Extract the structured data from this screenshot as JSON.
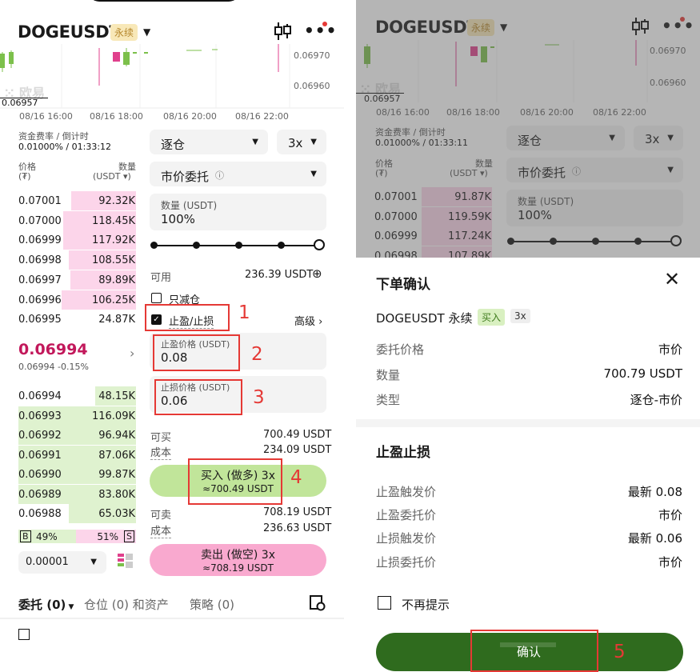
{
  "left": {
    "pair": "DOGEUSDT",
    "badge": "永续",
    "price_ticks": [
      "0.06970",
      "0.06960"
    ],
    "last_price_tag": "0.06957",
    "time_ticks": [
      "08/16 16:00",
      "08/16 18:00",
      "08/16 20:00",
      "08/16 22:00"
    ],
    "watermark": "欧易",
    "funding_label": "资金费率 / 倒计时",
    "funding_value": "0.01000% / 01:33:12",
    "price_col": "价格",
    "price_unit": "(₮)",
    "qty_col": "数量",
    "qty_unit": "(USDT ▾)",
    "asks": [
      {
        "price": "0.07001",
        "qty": "92.32K",
        "depth": 0.55
      },
      {
        "price": "0.07000",
        "qty": "118.45K",
        "depth": 0.62
      },
      {
        "price": "0.06999",
        "qty": "117.92K",
        "depth": 0.62
      },
      {
        "price": "0.06998",
        "qty": "108.55K",
        "depth": 0.57
      },
      {
        "price": "0.06997",
        "qty": "89.89K",
        "depth": 0.56
      },
      {
        "price": "0.06996",
        "qty": "106.25K",
        "depth": 0.63
      },
      {
        "price": "0.06995",
        "qty": "24.87K",
        "depth": 0.0
      }
    ],
    "mid_price": "0.06994",
    "mid_sub": "0.06994 -0.15%",
    "bids": [
      {
        "price": "0.06994",
        "qty": "48.15K",
        "depth": 0.35
      },
      {
        "price": "0.06993",
        "qty": "116.09K",
        "depth": 1.0
      },
      {
        "price": "0.06992",
        "qty": "96.94K",
        "depth": 1.0
      },
      {
        "price": "0.06991",
        "qty": "87.06K",
        "depth": 1.0
      },
      {
        "price": "0.06990",
        "qty": "99.87K",
        "depth": 1.0
      },
      {
        "price": "0.06989",
        "qty": "83.80K",
        "depth": 1.0
      },
      {
        "price": "0.06988",
        "qty": "65.03K",
        "depth": 0.57
      }
    ],
    "buy_ratio_badge": "B",
    "buy_ratio": "49%",
    "sell_ratio": "51%",
    "sell_ratio_badge": "S",
    "buy_ratio_value": 0.49,
    "precision": "0.00001",
    "margin_mode": "逐仓",
    "leverage": "3x",
    "order_type": "市价委托",
    "qty_label": "数量 (USDT)",
    "qty_value": "100%",
    "available_label": "可用",
    "available_value": "236.39 USDT",
    "reduce_only": "只减仓",
    "tpsl": "止盈/止损",
    "advanced": "高级",
    "tp_label": "止盈价格 (USDT)",
    "tp_value": "0.08",
    "sl_label": "止损价格 (USDT)",
    "sl_value": "0.06",
    "can_buy_label": "可买",
    "can_buy_value": "700.49 USDT",
    "cost_label": "成本",
    "cost_buy_value": "234.09 USDT",
    "buy_btn": "买入 (做多) 3x",
    "buy_btn_sub": "≈700.49 USDT",
    "can_sell_label": "可卖",
    "can_sell_value": "708.19 USDT",
    "cost_sell_value": "236.63 USDT",
    "sell_btn": "卖出 (做空) 3x",
    "sell_btn_sub": "≈708.19 USDT",
    "tab_orders": "委托 (0)",
    "tab_positions": "仓位 (0) 和资产",
    "tab_strategy": "策略 (0)",
    "annotations": [
      "1",
      "2",
      "3",
      "4"
    ]
  },
  "right": {
    "pair": "DOGEUSDT",
    "badge": "永续",
    "price_ticks": [
      "0.06970",
      "0.06960"
    ],
    "last_price_tag": "0.06957",
    "time_ticks": [
      "08/16 16:00",
      "08/16 18:00",
      "08/16 20:00",
      "08/16 22:00"
    ],
    "watermark": "欧易",
    "funding_label": "资金费率 / 倒计时",
    "funding_value": "0.01000% / 01:33:11",
    "price_col": "价格",
    "price_unit": "(₮)",
    "qty_col": "数量",
    "qty_unit": "(USDT ▾)",
    "asks": [
      {
        "price": "0.07001",
        "qty": "91.87K"
      },
      {
        "price": "0.07000",
        "qty": "119.59K"
      },
      {
        "price": "0.06999",
        "qty": "117.24K"
      },
      {
        "price": "0.06998",
        "qty": "107.89K"
      }
    ],
    "margin_mode": "逐仓",
    "leverage": "3x",
    "order_type": "市价委托",
    "qty_label": "数量 (USDT)",
    "qty_value": "100%",
    "sheet_title": "下单确认",
    "sheet_pair": "DOGEUSDT 永续",
    "tag_buy": "买入",
    "tag_lev": "3x",
    "rows": [
      {
        "k": "委托价格",
        "v": "市价"
      },
      {
        "k": "数量",
        "v": "700.79 USDT"
      },
      {
        "k": "类型",
        "v": "逐仓-市价"
      }
    ],
    "tpsl_title": "止盈止损",
    "tpsl_rows": [
      {
        "k": "止盈触发价",
        "v": "最新 0.08"
      },
      {
        "k": "止盈委托价",
        "v": "市价"
      },
      {
        "k": "止损触发价",
        "v": "最新 0.06"
      },
      {
        "k": "止损委托价",
        "v": "市价"
      }
    ],
    "no_remind": "不再提示",
    "confirm_btn": "确认",
    "annotation": "5"
  }
}
